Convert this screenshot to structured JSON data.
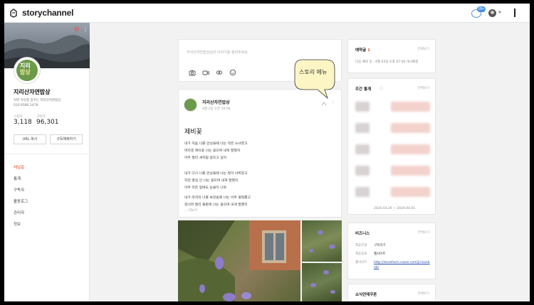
{
  "app": {
    "brand": "storychannel",
    "notice_count": "99+"
  },
  "colors": {
    "accent": "#e8542c",
    "brand_green": "#6b9a4a",
    "link": "#2a4fb0"
  },
  "sidebar": {
    "profile_text_line1": "지리",
    "profile_text_line2": "밥상",
    "channel_name": "지리산자연밥상",
    "description": "자연 자유롭 꿈꾸는 지리산자연밥상 010.9586.1478",
    "stats": [
      {
        "label": "스토리",
        "value": "3,118"
      },
      {
        "label": "구독자",
        "value": "96,301"
      }
    ],
    "buttons": {
      "url_copy": "URL 복사",
      "subscribe": "구독해제하기"
    },
    "menu": [
      {
        "label": "채널홈",
        "active": true
      },
      {
        "label": "통계",
        "active": false
      },
      {
        "label": "구독자",
        "active": false
      },
      {
        "label": "활동로그",
        "active": false
      },
      {
        "label": "관리자",
        "active": false
      },
      {
        "label": "정보",
        "active": false
      }
    ]
  },
  "composer": {
    "placeholder": "지리산자연밥상님의 이야기를 들려주세요",
    "tools": [
      "camera-icon",
      "video-icon",
      "link-icon",
      "emoji-icon"
    ]
  },
  "bubble": {
    "text": "스토리 메뉴"
  },
  "post": {
    "author": "지리산자연밥상",
    "date": "4월 2일 오전 10:04",
    "title": "제비꽃",
    "lines": [
      "내가 처음 너를 만났을때 너는 작은 소녀였고",
      "머리엔 제비꽃 너는 꽃으며 내게 말했지",
      "아주 멀리 새처럼 날으고 싶어",
      "",
      "내가 다시 너를 만났을때 너는 많이 야위었고",
      "하얀 병실 안 너는 꽃으며 내게 말했지",
      "아주 작은 일에도 눈물이 나와",
      "",
      "내가 마지막 너를 보았을때 너는 아주 평화롭고",
      "창너머 멀리 들판에 너는 꽃으며 내게 말했지",
      "..."
    ],
    "more_link": "... 더보기"
  },
  "right": {
    "reservation": {
      "title": "예약글",
      "count": "1",
      "link": "전체보기",
      "text": "다음 예약 글 : 4월 03일 오후 07:00 게시예정"
    },
    "weekly": {
      "title": "주간 통계",
      "link": "전체보기",
      "range": "2020.03.26 ~ 2020.04.01"
    },
    "business": {
      "title": "비즈니스",
      "link": "전체보기",
      "rows": [
        {
          "label": "제휴유형",
          "value": "구독하기"
        },
        {
          "label": "제휴종류",
          "value": "웹사이트"
        },
        {
          "label": "웹사이트",
          "value": "http://storefarm.naver.com/jirisanbob/"
        }
      ]
    },
    "links_card": {
      "title": "소식연재쿠폰",
      "link": "전체보기"
    }
  }
}
